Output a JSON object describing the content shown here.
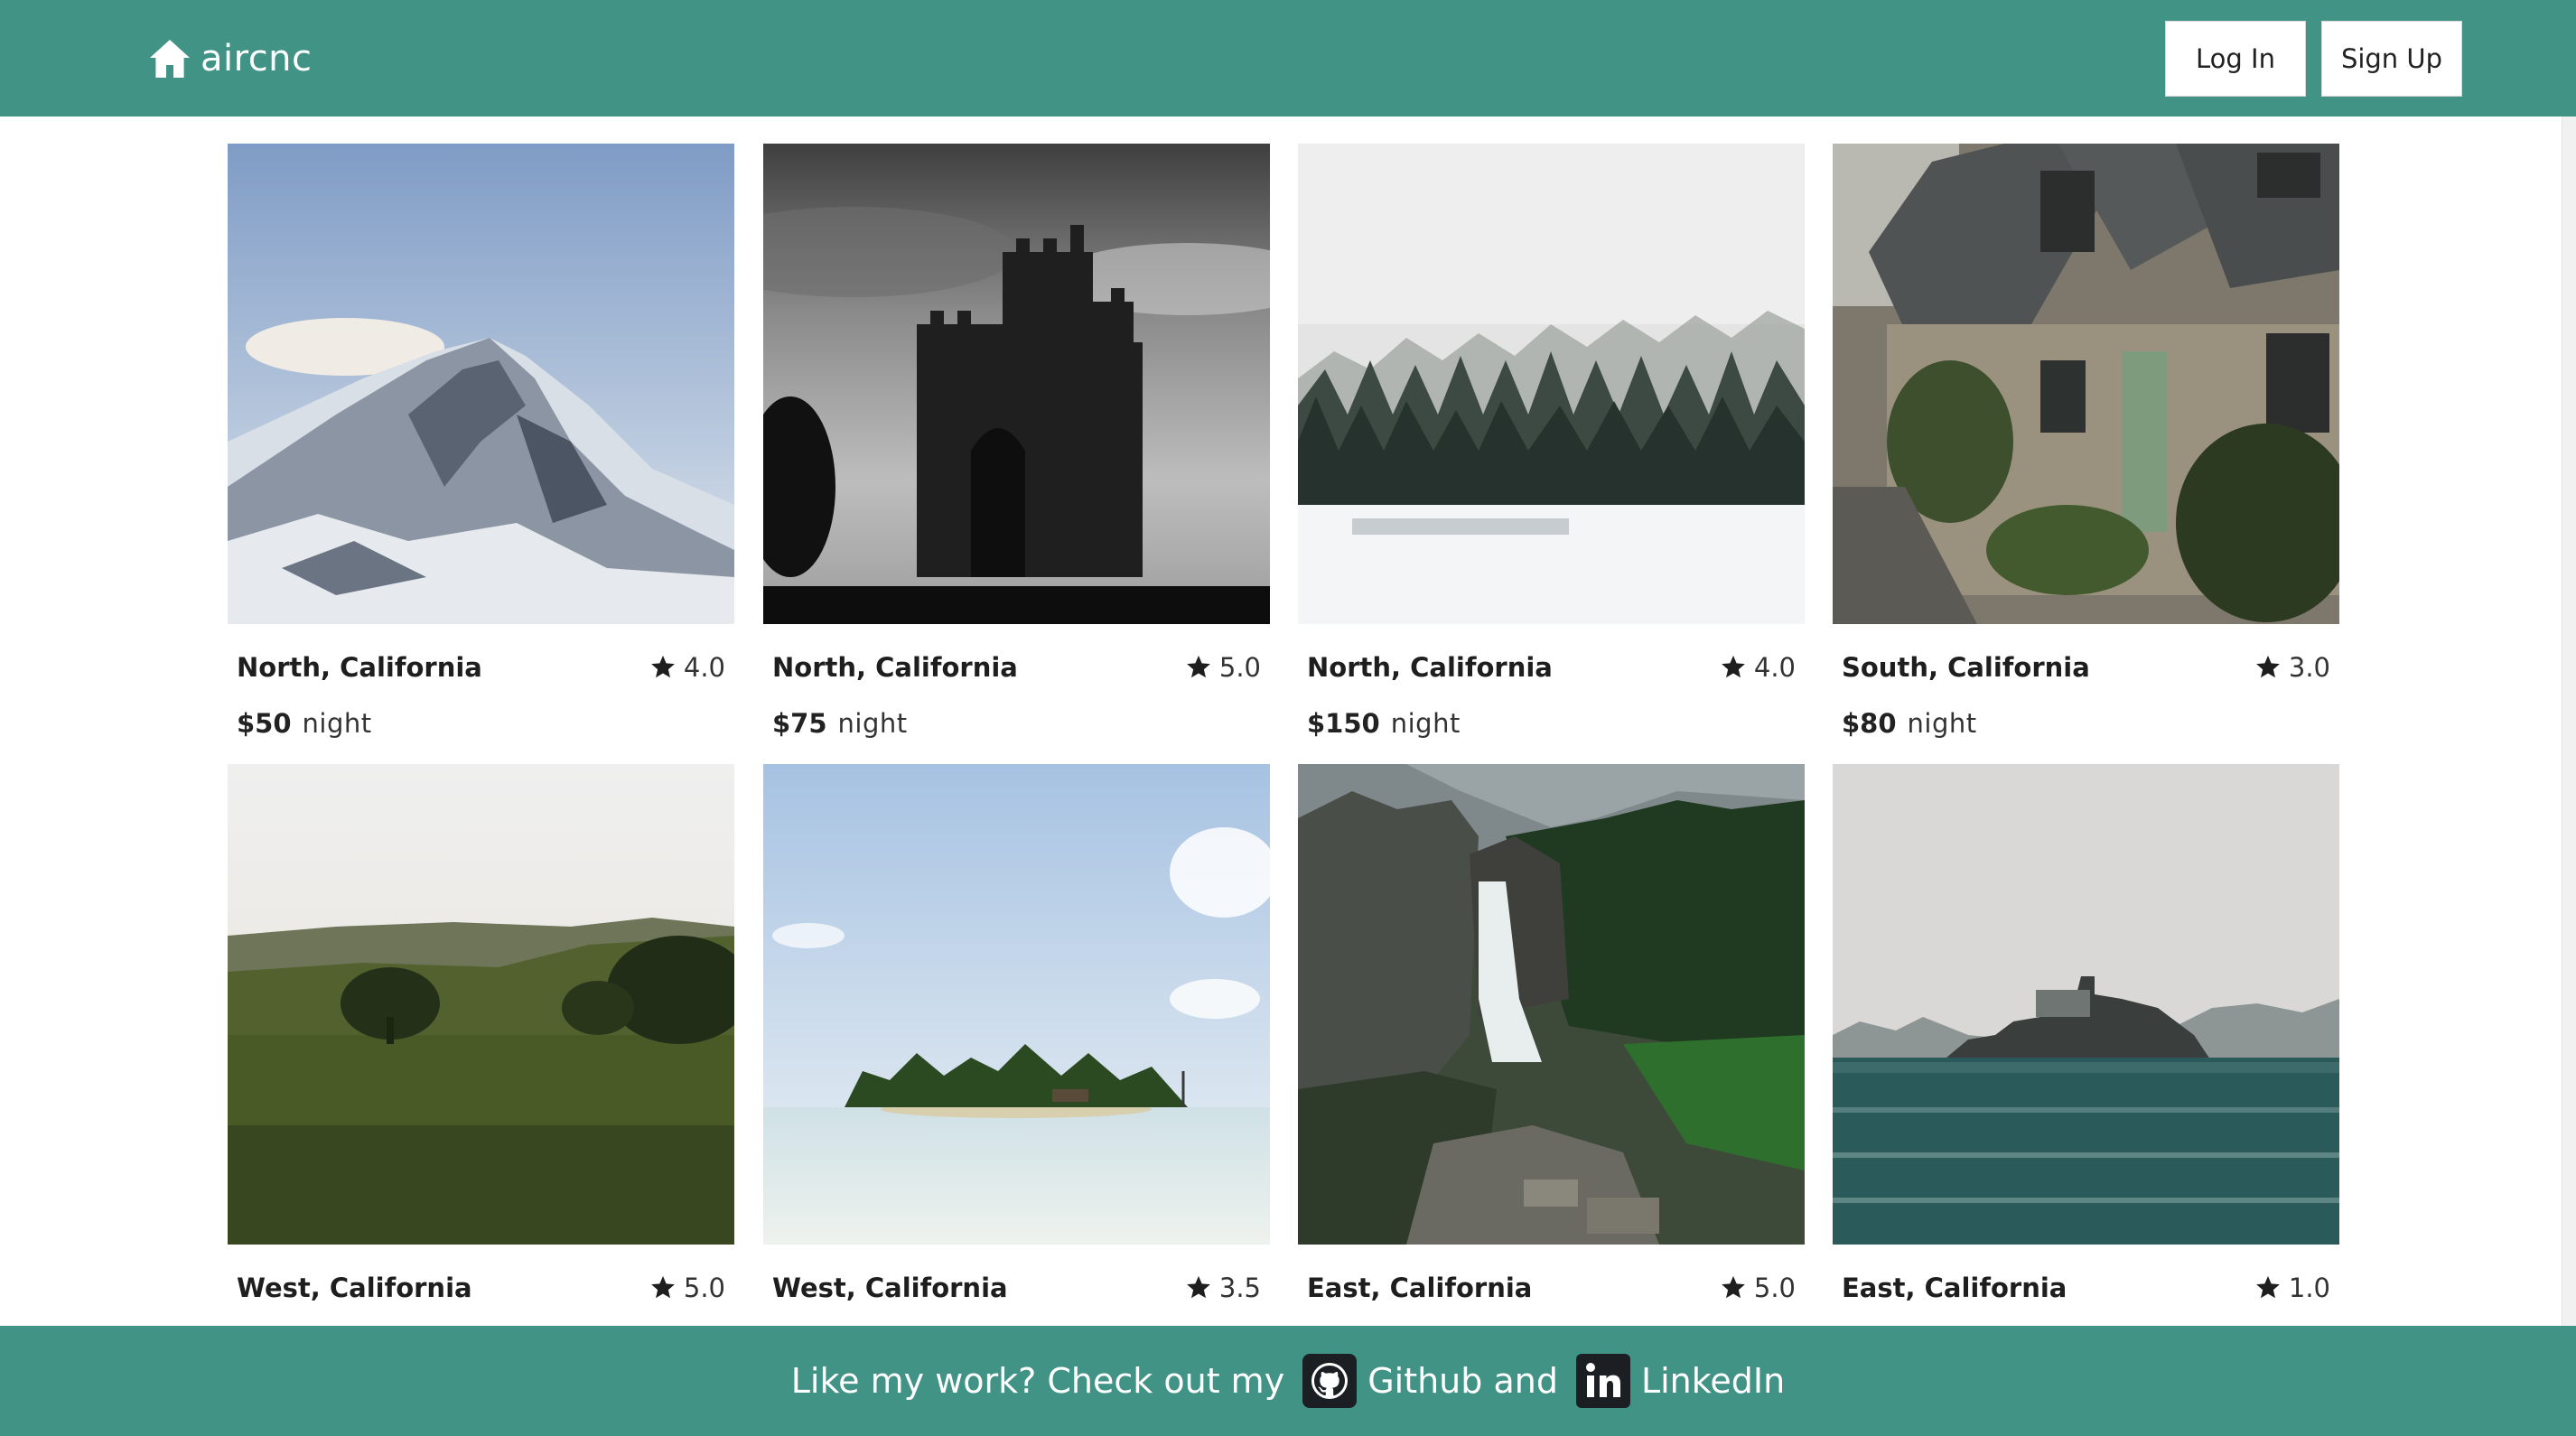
{
  "header": {
    "logo_text": "aircnc",
    "login_label": "Log In",
    "signup_label": "Sign Up"
  },
  "listings": [
    {
      "location": "North, California",
      "rating": "4.0",
      "price": "$50",
      "unit": "night",
      "image": "snowy-mountain"
    },
    {
      "location": "North, California",
      "rating": "5.0",
      "price": "$75",
      "unit": "night",
      "image": "castle"
    },
    {
      "location": "North, California",
      "rating": "4.0",
      "price": "$150",
      "unit": "night",
      "image": "snowy-forest"
    },
    {
      "location": "South, California",
      "rating": "3.0",
      "price": "$80",
      "unit": "night",
      "image": "stone-cottages"
    },
    {
      "location": "West, California",
      "rating": "5.0",
      "image": "green-meadow"
    },
    {
      "location": "West, California",
      "rating": "3.5",
      "image": "tropical-island"
    },
    {
      "location": "East, California",
      "rating": "5.0",
      "image": "waterfall"
    },
    {
      "location": "East, California",
      "rating": "1.0",
      "image": "alcatraz-island"
    }
  ],
  "footer": {
    "text": "Like my work? Check out my",
    "github_label": "Github and",
    "linkedin_label": "LinkedIn"
  },
  "colors": {
    "brand": "#419386",
    "star": "#1e1e1e"
  }
}
